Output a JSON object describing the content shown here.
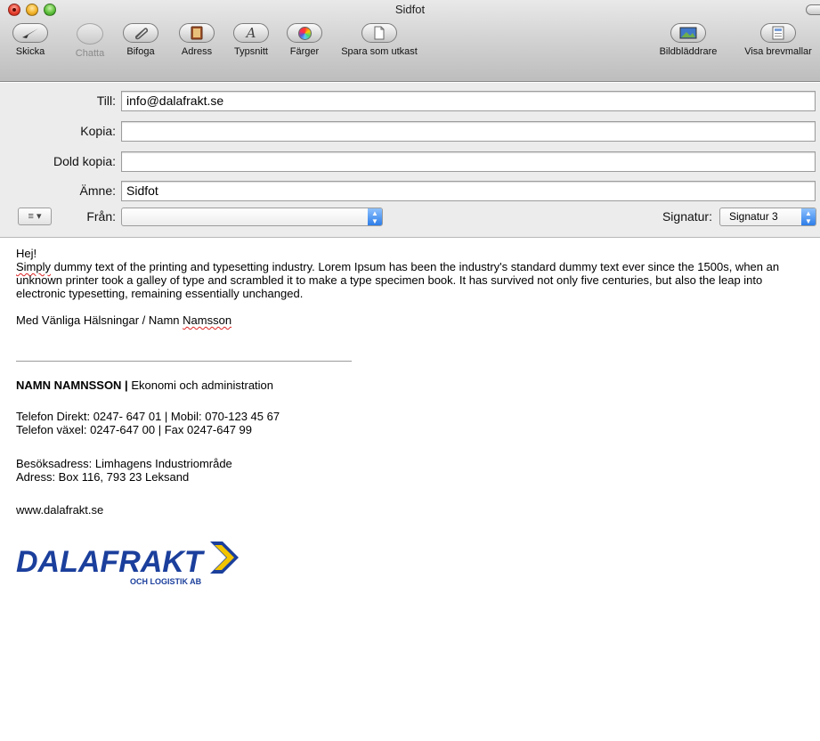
{
  "window": {
    "title": "Sidfot"
  },
  "toolbar": {
    "send": "Skicka",
    "chat": "Chatta",
    "attach": "Bifoga",
    "address": "Adress",
    "fonts": "Typsnitt",
    "colors": "Färger",
    "save_draft": "Spara som utkast",
    "photo_browser": "Bildbläddrare",
    "show_templates": "Visa brevmallar"
  },
  "headers": {
    "to_label": "Till:",
    "to_value": "info@dalafrakt.se",
    "cc_label": "Kopia:",
    "cc_value": "",
    "bcc_label": "Dold kopia:",
    "bcc_value": "",
    "subject_label": "Ämne:",
    "subject_value": "Sidfot",
    "from_label": "Från:",
    "from_value": "",
    "signature_label": "Signatur:",
    "signature_value": "Signatur 3"
  },
  "message": {
    "greeting": "Hej!",
    "para_word1": "Simply",
    "para_rest": " dummy text of the printing and typesetting industry. Lorem Ipsum has been the industry's standard dummy text ever since the 1500s, when an unknown printer took a galley of type and scrambled it to make a type specimen book. It has survived not only five centuries, but also the leap into electronic typesetting, remaining essentially unchanged.",
    "closing_prefix": "Med Vänliga Hälsningar / Namn ",
    "closing_name": "Namsson"
  },
  "signature": {
    "name": "NAMN NAMNSSON |",
    "dept": " Ekonomi och administration",
    "phone_line": "Telefon Direkt: 0247- 647 01  |  Mobil: 070-123 45 67",
    "switchboard_line": "Telefon växel: 0247-647 00  |  Fax 0247-647 99",
    "visit_line": "Besöksadress: Limhagens Industriområde",
    "address_line": "Adress: Box 116, 793 23 Leksand",
    "web": "www.dalafrakt.se",
    "logo_text": "DALAFRAKT",
    "logo_sub": "OCH LOGISTIK AB"
  },
  "colors": {
    "logo_blue": "#1b3f9c",
    "logo_yellow": "#f2c400",
    "spell_red": "#dd2222"
  }
}
